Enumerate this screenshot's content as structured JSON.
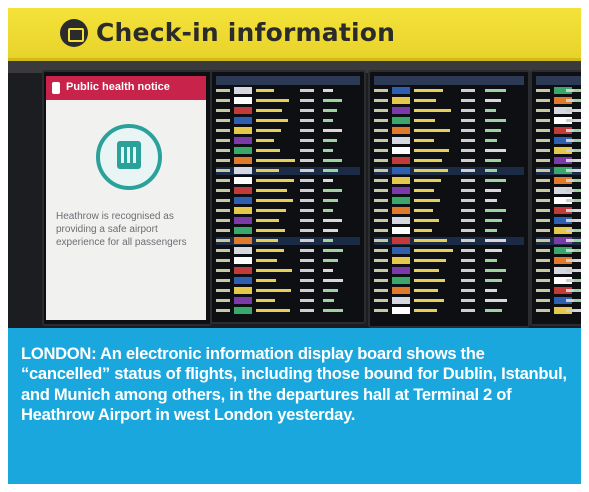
{
  "sign": {
    "title": "Check-in information"
  },
  "notice_screen": {
    "title": "Public health notice",
    "body": "Heathrow is recognised as providing a safe airport experience for all passengers"
  },
  "caption": {
    "text": "LONDON: An electronic information display board shows the “cancelled” status of flights, including those bound for Dublin, Istanbul, and Munich among others, in the departures hall at Terminal 2 of Heathrow Airport in west London yesterday."
  },
  "colors": {
    "caption_bg": "#1aa7de",
    "sign_bg": "#f4e23a",
    "notice_header": "#c8234a",
    "board_bg": "#0d0f12"
  },
  "icons": {
    "sign_icon": "airplane-ticket-icon",
    "notice_seal": "safety-seal-icon"
  }
}
